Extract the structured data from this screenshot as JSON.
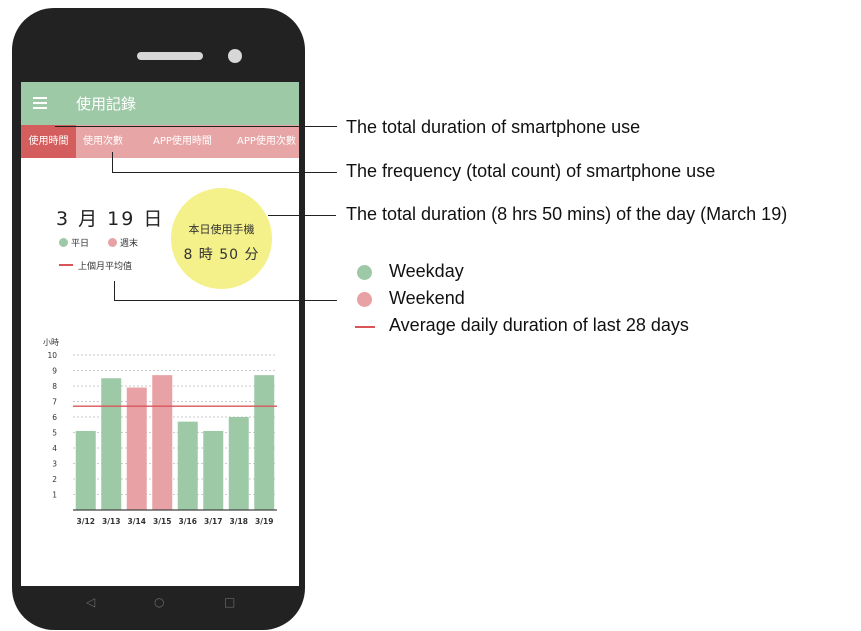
{
  "app": {
    "title": "使用記錄"
  },
  "tabs": [
    "使用時間",
    "使用次數",
    "APP使用時間",
    "APP使用次數"
  ],
  "date": "3 月 19 日",
  "mini_legend": {
    "weekday": "平日",
    "weekend": "週末",
    "average": "上個月平均值"
  },
  "today_total": {
    "label": "本日使用手機",
    "value": "8 時 50 分"
  },
  "chart_data": {
    "type": "bar",
    "ylabel": "小時",
    "ylim": [
      0,
      10
    ],
    "yticks": [
      "1",
      "2",
      "3",
      "4",
      "5",
      "6",
      "7",
      "8",
      "9",
      "10"
    ],
    "categories": [
      "3/12",
      "3/13",
      "3/14",
      "3/15",
      "3/16",
      "3/17",
      "3/18",
      "3/19"
    ],
    "values": [
      5.1,
      8.5,
      7.9,
      8.7,
      5.7,
      5.1,
      6.0,
      8.7
    ],
    "day_type": [
      "weekday",
      "weekday",
      "weekend",
      "weekend",
      "weekday",
      "weekday",
      "weekday",
      "weekday"
    ],
    "average_line": 6.7,
    "colors": {
      "weekday": "#9ec9a7",
      "weekend": "#e8a2a5",
      "average": "#d9555a"
    }
  },
  "annotations": {
    "tab_duration": "The total duration of smartphone use",
    "tab_frequency": "The frequency (total count) of smartphone use",
    "day_total": "The total duration (8 hrs 50 mins) of the day (March 19)"
  },
  "legend": {
    "weekday": "Weekday",
    "weekend": "Weekend",
    "average": "Average daily duration of last 28 days"
  },
  "colors": {
    "appbar": "#9ec9a7",
    "tab_bar": "#e8a5a5",
    "tab_active": "#d45d5d",
    "bubble": "#f4f08a",
    "phone": "#222222"
  }
}
